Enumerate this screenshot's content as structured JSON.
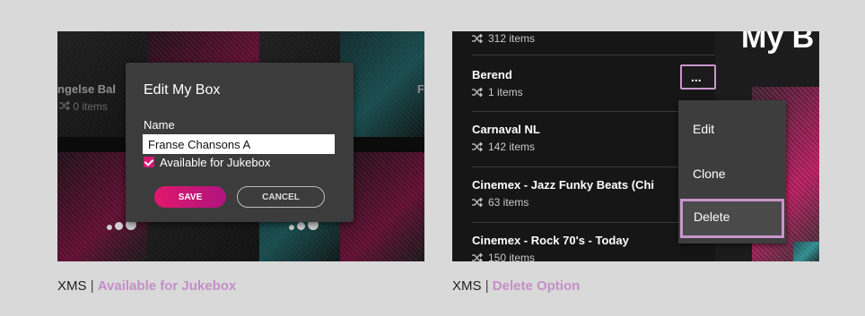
{
  "left_panel": {
    "tile_label_left": "ngelse Bal",
    "tile_count_left": "0 items",
    "tile_label_right": "F",
    "modal": {
      "title": "Edit My Box",
      "name_label": "Name",
      "name_value": "Franse Chansons A",
      "checkbox_label": "Available for Jukebox",
      "checkbox_checked": true,
      "save_label": "SAVE",
      "cancel_label": "CANCEL"
    },
    "caption": {
      "prefix": "XMS",
      "separator": "|",
      "highlight": "Available for Jukebox"
    }
  },
  "right_panel": {
    "page_title": "My B",
    "list": [
      {
        "title": "",
        "count": "312 items"
      },
      {
        "title": "Berend",
        "count": "1 items"
      },
      {
        "title": "Carnaval NL",
        "count": "142 items"
      },
      {
        "title": "Cinemex - Jazz Funky Beats (Chi",
        "count": "63 items"
      },
      {
        "title": "Cinemex - Rock 70's - Today",
        "count": "150 items"
      }
    ],
    "more_button_label": "...",
    "context_menu": {
      "items": [
        "Edit",
        "Clone",
        "Delete"
      ]
    },
    "caption": {
      "prefix": "XMS",
      "separator": "|",
      "highlight": "Delete Option"
    }
  },
  "colors": {
    "accent_pink": "#d11a74",
    "highlight_purple": "#c896cc",
    "background": "#d9d9d9"
  }
}
